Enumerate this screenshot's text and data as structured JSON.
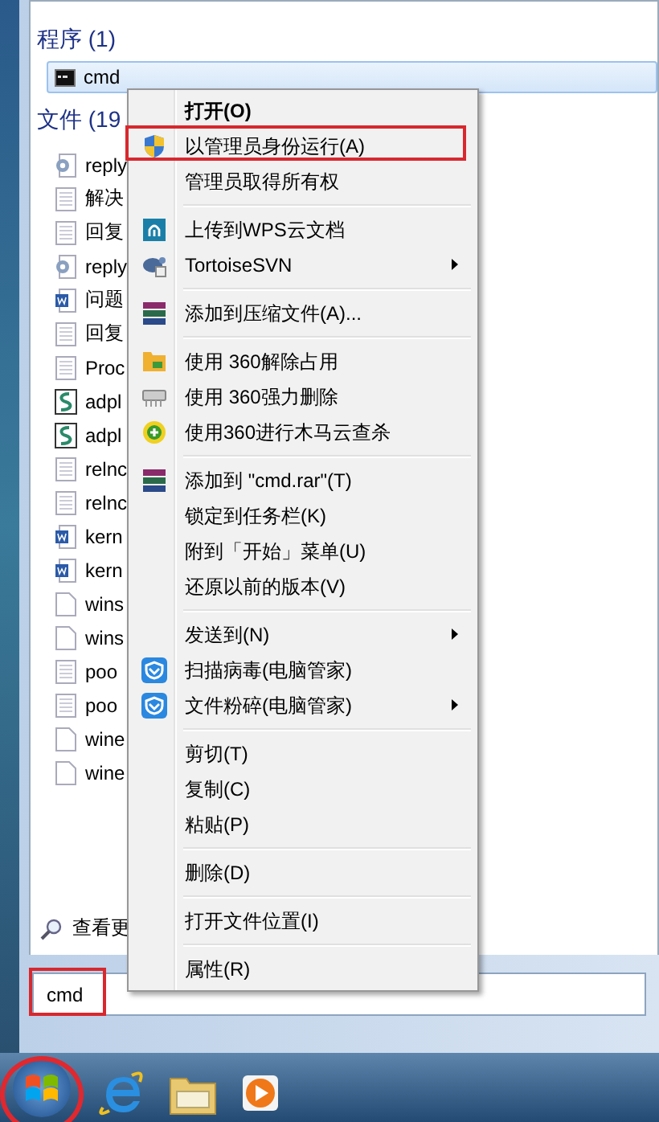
{
  "programs": {
    "heading": "程序 (1)",
    "items": [
      {
        "label": "cmd",
        "selected": true
      }
    ]
  },
  "files": {
    "heading": "文件 (19",
    "items": [
      {
        "label": "reply",
        "kind": "config"
      },
      {
        "label": "解决",
        "kind": "text"
      },
      {
        "label": "回复",
        "kind": "text"
      },
      {
        "label": "reply",
        "kind": "config"
      },
      {
        "label": "问题",
        "kind": "word"
      },
      {
        "label": "回复",
        "kind": "text"
      },
      {
        "label": "Proc",
        "kind": "text"
      },
      {
        "label": "adpl",
        "kind": "script"
      },
      {
        "label": "adpl",
        "kind": "script"
      },
      {
        "label": "relnc",
        "kind": "text"
      },
      {
        "label": "relnc",
        "kind": "text"
      },
      {
        "label": "kern",
        "kind": "word"
      },
      {
        "label": "kern",
        "kind": "word"
      },
      {
        "label": "wins",
        "kind": "blank"
      },
      {
        "label": "wins",
        "kind": "blank"
      },
      {
        "label": "poo",
        "kind": "text"
      },
      {
        "label": "poo",
        "kind": "text"
      },
      {
        "label": "wine",
        "kind": "blank"
      },
      {
        "label": "wine",
        "kind": "blank"
      }
    ]
  },
  "see_more": "查看更",
  "search": {
    "value": "cmd",
    "annotated": true
  },
  "start_button": {
    "annotated": true
  },
  "context_menu": {
    "groups": [
      [
        {
          "label": "打开(O)",
          "default": true,
          "submenu": false,
          "annotated": false
        },
        {
          "label": "以管理员身份运行(A)",
          "default": false,
          "submenu": false,
          "annotated": true
        },
        {
          "label": "管理员取得所有权",
          "default": false,
          "submenu": false,
          "annotated": false
        }
      ],
      [
        {
          "label": "上传到WPS云文档",
          "default": false,
          "submenu": false,
          "annotated": false
        },
        {
          "label": "TortoiseSVN",
          "default": false,
          "submenu": true,
          "annotated": false
        }
      ],
      [
        {
          "label": "添加到压缩文件(A)...",
          "default": false,
          "submenu": false,
          "annotated": false
        }
      ],
      [
        {
          "label": "使用 360解除占用",
          "default": false,
          "submenu": false,
          "annotated": false
        },
        {
          "label": "使用 360强力删除",
          "default": false,
          "submenu": false,
          "annotated": false
        },
        {
          "label": "使用360进行木马云查杀",
          "default": false,
          "submenu": false,
          "annotated": false
        }
      ],
      [
        {
          "label": "添加到 \"cmd.rar\"(T)",
          "default": false,
          "submenu": false,
          "annotated": false
        },
        {
          "label": "锁定到任务栏(K)",
          "default": false,
          "submenu": false,
          "annotated": false
        },
        {
          "label": "附到「开始」菜单(U)",
          "default": false,
          "submenu": false,
          "annotated": false
        },
        {
          "label": "还原以前的版本(V)",
          "default": false,
          "submenu": false,
          "annotated": false
        }
      ],
      [
        {
          "label": "发送到(N)",
          "default": false,
          "submenu": true,
          "annotated": false
        },
        {
          "label": "扫描病毒(电脑管家)",
          "default": false,
          "submenu": false,
          "annotated": false
        },
        {
          "label": "文件粉碎(电脑管家)",
          "default": false,
          "submenu": true,
          "annotated": false
        }
      ],
      [
        {
          "label": "剪切(T)",
          "default": false,
          "submenu": false,
          "annotated": false
        },
        {
          "label": "复制(C)",
          "default": false,
          "submenu": false,
          "annotated": false
        },
        {
          "label": "粘贴(P)",
          "default": false,
          "submenu": false,
          "annotated": false
        }
      ],
      [
        {
          "label": "删除(D)",
          "default": false,
          "submenu": false,
          "annotated": false
        }
      ],
      [
        {
          "label": "打开文件位置(I)",
          "default": false,
          "submenu": false,
          "annotated": false
        }
      ],
      [
        {
          "label": "属性(R)",
          "default": false,
          "submenu": false,
          "annotated": false
        }
      ]
    ]
  }
}
